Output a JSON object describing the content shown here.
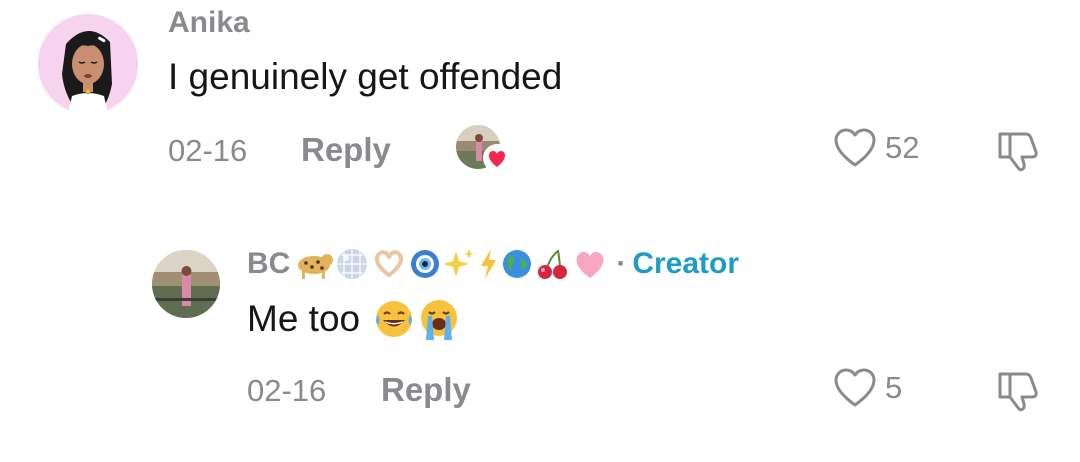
{
  "comments": [
    {
      "username": "Anika",
      "text": "I genuinely get offended",
      "date": "02-16",
      "reply_label": "Reply",
      "likes": "52",
      "avatar_icon": "cartoon-girl-avatar-icon",
      "creator_liked_icon": "creator-heart-badge-icon"
    },
    {
      "username": "BC",
      "username_emojis": [
        "leopard",
        "mirror-ball",
        "heart-hands",
        "nazar-amulet",
        "sparkles",
        "high-voltage",
        "globe",
        "cherries",
        "pink-heart"
      ],
      "separator": "·",
      "badge": "Creator",
      "text": "Me too",
      "text_emojis": [
        "face-with-tears-of-joy",
        "loudly-crying-face"
      ],
      "date": "02-16",
      "reply_label": "Reply",
      "likes": "5",
      "avatar_icon": "photo-avatar-icon"
    }
  ],
  "colors": {
    "secondary_text": "#8a8a8e",
    "primary_text": "#161616",
    "creator_accent": "#1e9cc8",
    "heart_badge": "#f0274f"
  }
}
